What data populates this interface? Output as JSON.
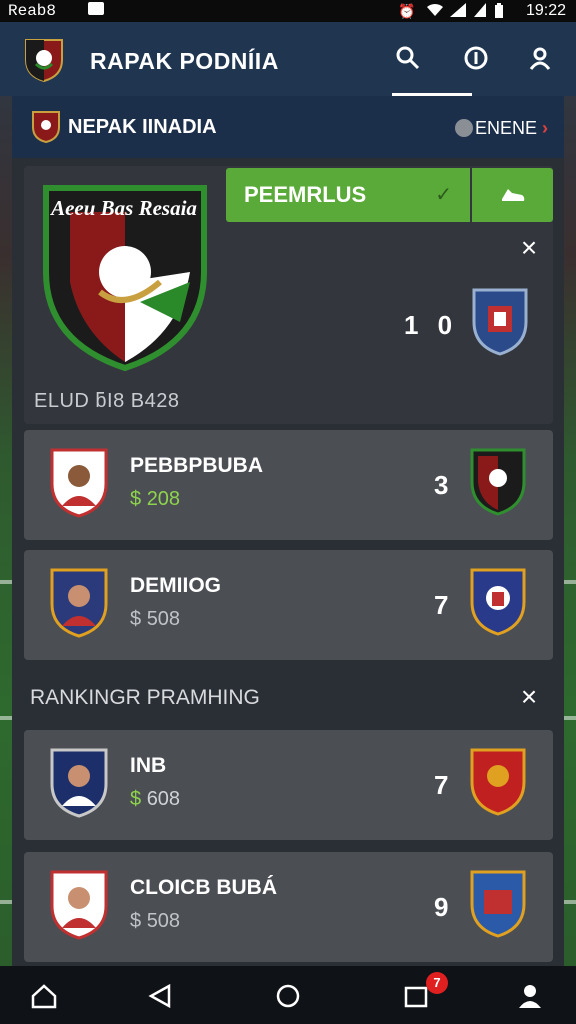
{
  "status_bar": {
    "carrier": "Reab8",
    "time": "19:22"
  },
  "app": {
    "title": "RAPAK PODNÍIA"
  },
  "subheader": {
    "team_name": "NEPAK IINADIA",
    "more_label": "ENENE"
  },
  "featured": {
    "crest_text": "Aeeu Bas Resaia",
    "action_label": "PEEMRLUS",
    "score": "1 0",
    "club_label": "ELUD ƃI8 B428"
  },
  "players": [
    {
      "name": "PEBBPBUBA",
      "price_symbol": "$",
      "price": "208",
      "score": "3"
    },
    {
      "name": "DEMIIOG",
      "price_symbol": "$",
      "price": "508",
      "score": "7"
    }
  ],
  "ranking": {
    "title": "RANKINGR PRAMHING",
    "players": [
      {
        "name": "INB",
        "price_symbol": "$",
        "price": "608",
        "score": "7"
      },
      {
        "name": "CLOICB BUBÁ",
        "price_symbol": "$",
        "price": "508",
        "score": "9"
      }
    ]
  },
  "nav": {
    "notification_count": "7"
  },
  "colors": {
    "accent_green": "#5aaa3a",
    "header_blue": "#1f3550",
    "price_green": "#8ed34e"
  }
}
